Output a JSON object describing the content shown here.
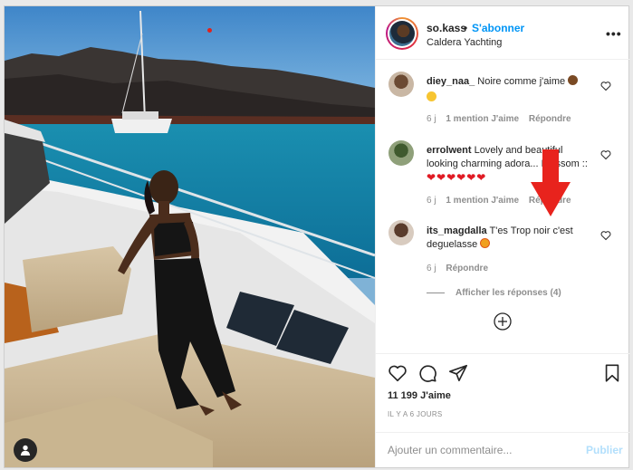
{
  "post": {
    "username": "so.kass",
    "separator": "•",
    "follow_label": "S'abonner",
    "location": "Caldera Yachting",
    "more_label": "•••"
  },
  "comments": [
    {
      "username": "diey_naa_",
      "text": "Noire comme j'aime",
      "time": "6 j",
      "likes": "1 mention J'aime",
      "reply": "Répondre"
    },
    {
      "username": "errolwent",
      "text": "Lovely and beautiful looking charming adora... Blossom ::",
      "hearts": "❤❤❤❤❤❤",
      "time": "6 j",
      "likes": "1 mention J'aime",
      "reply": "Répondre"
    },
    {
      "username": "its_magdalla",
      "text": "T'es Trop noir c'est deguelasse",
      "time": "6 j",
      "reply": "Répondre"
    }
  ],
  "view_replies": "Afficher les réponses (4)",
  "likes_count": "11 199 J'aime",
  "date": "IL Y A 6 JOURS",
  "comment_input": {
    "placeholder": "Ajouter un commentaire...",
    "post_label": "Publier"
  },
  "colors": {
    "accent": "#0095f6",
    "arrow": "#e8231d"
  }
}
